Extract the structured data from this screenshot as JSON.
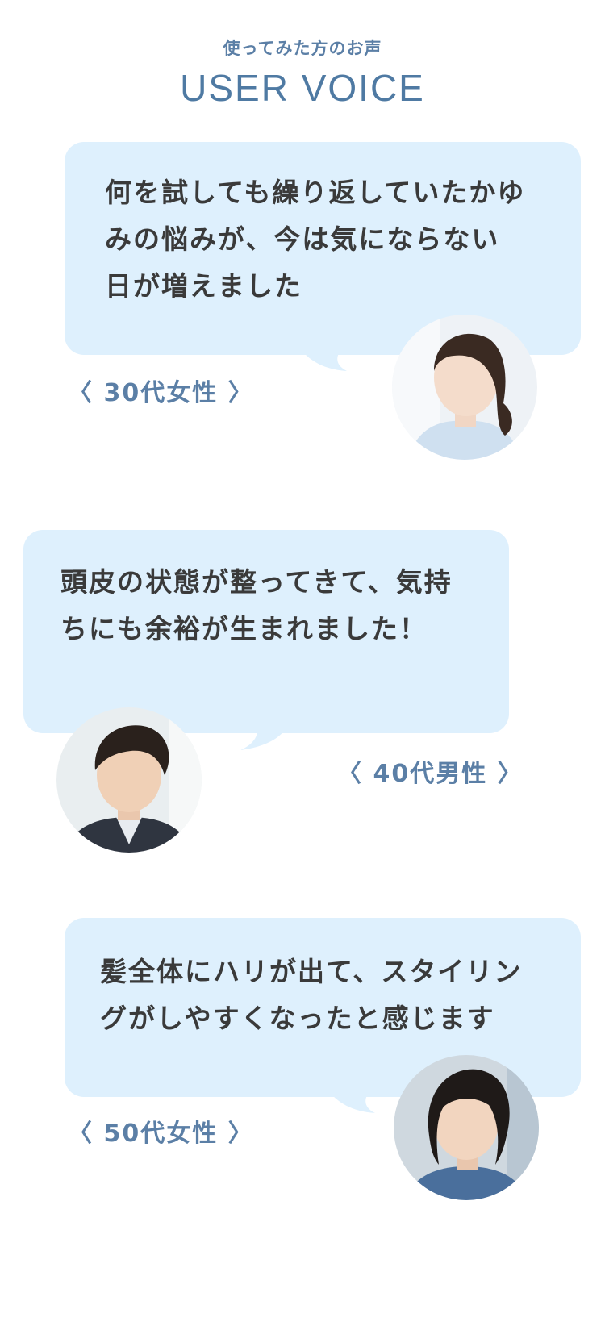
{
  "header": {
    "subtitle": "使ってみた方のお声",
    "title": "USER VOICE"
  },
  "voices": [
    {
      "lines": [
        "何を試しても繰り返していたかゆ",
        "みの悩みが、今は気にならない",
        "日が増えました"
      ],
      "label": "〈 30代女性 〉",
      "avatar": "woman-30s-portrait"
    },
    {
      "lines": [
        "頭皮の状態が整ってきて、気持",
        "ちにも余裕が生まれました！"
      ],
      "label": "〈 40代男性 〉",
      "avatar": "man-40s-portrait"
    },
    {
      "lines": [
        "髪全体にハリが出て、スタイリン",
        "グがしやすくなったと感じます"
      ],
      "label": "〈 50代女性 〉",
      "avatar": "woman-50s-portrait"
    }
  ],
  "colors": {
    "bubble": "#def0fd",
    "accent": "#4f7aa3",
    "text": "#3a3a3a"
  }
}
